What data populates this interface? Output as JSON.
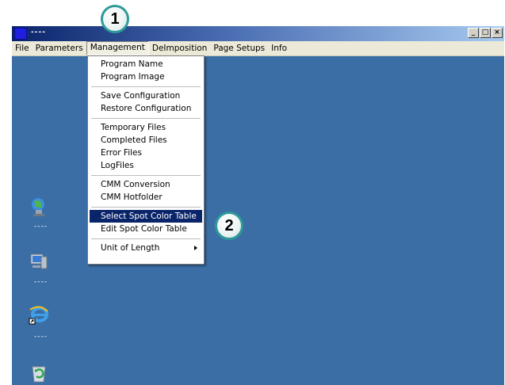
{
  "window": {
    "title": "----",
    "caption_buttons": {
      "minimize": "_",
      "maximize": "□",
      "close": "×"
    }
  },
  "menubar": {
    "items": [
      "File",
      "Parameters",
      "Management",
      "DeImposition",
      "Page Setups",
      "Info"
    ],
    "active": "Management"
  },
  "management_menu": {
    "groups": [
      [
        "Program Name",
        "Program Image"
      ],
      [
        "Save Configuration",
        "Restore Configuration"
      ],
      [
        "Temporary Files",
        "Completed Files",
        "Error Files",
        "LogFiles"
      ],
      [
        "CMM Conversion",
        "CMM Hotfolder"
      ],
      [
        "Select Spot Color Table",
        "Edit Spot Color Table"
      ],
      [
        "Unit of Length"
      ]
    ],
    "highlighted": "Select Spot Color Table",
    "submenu_items": [
      "Unit of Length"
    ]
  },
  "desktop_icons": [
    {
      "icon": "network-icon",
      "label": "----"
    },
    {
      "icon": "computer-icon",
      "label": "----"
    },
    {
      "icon": "internet-explorer-icon",
      "label": "----"
    },
    {
      "icon": "recycle-bin-icon",
      "label": ""
    }
  ],
  "callouts": [
    "1",
    "2"
  ],
  "colors": {
    "desktop": "#3a6ea5",
    "menu_highlight": "#0a246a",
    "callout_border": "#2f9a9a"
  }
}
